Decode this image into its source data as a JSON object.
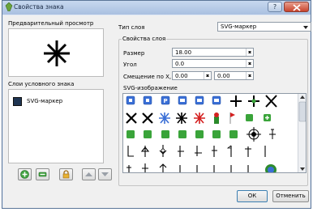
{
  "window": {
    "title": "Свойства знака"
  },
  "preview": {
    "label": "Предварительный просмотр"
  },
  "layers": {
    "label": "Слои условного знака",
    "items": [
      {
        "label": "SVG-маркер",
        "color": "#1f3552"
      }
    ]
  },
  "layer_type": {
    "label": "Тип слоя",
    "value": "SVG-маркер"
  },
  "props": {
    "group_label": "Свойства слоя",
    "size_label": "Размер",
    "size_value": "18.00",
    "angle_label": "Угол",
    "angle_value": "0.0",
    "offset_label": "Смещение по X, Y",
    "offset_x": "0.00",
    "offset_y": "0.00"
  },
  "svg_image": {
    "label": "SVG-изображение"
  },
  "footer": {
    "ok_label": "ОК",
    "cancel_label": "Отменить"
  },
  "colors": {
    "accent": "#2f6fd0",
    "symbol_blue": "#3a6fd6",
    "symbol_green": "#3aa43a"
  }
}
